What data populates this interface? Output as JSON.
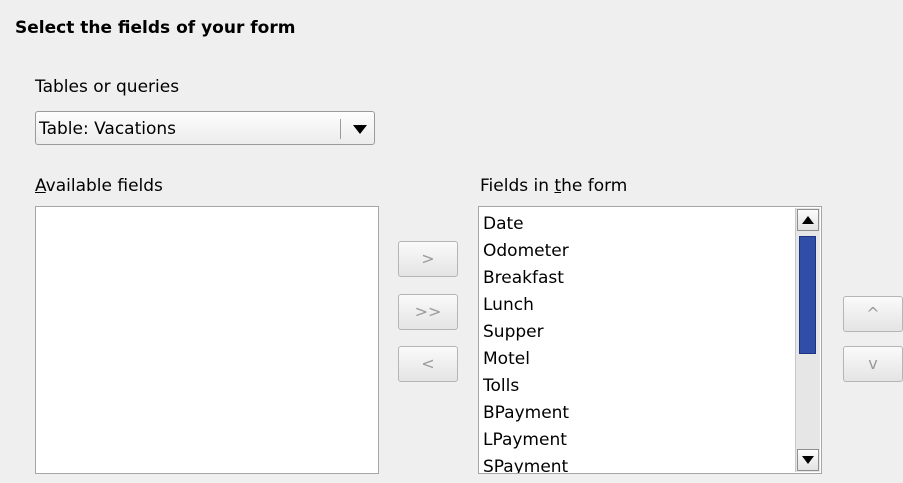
{
  "title": "Select the fields of your form",
  "tables": {
    "label": "Tables or queries",
    "selected": "Table: Vacations"
  },
  "available": {
    "label_prefix": "",
    "label_u": "A",
    "label_rest": "vailable fields",
    "items": []
  },
  "in_form": {
    "label_prefix": "Fields in ",
    "label_u": "t",
    "label_rest": "he form",
    "items": [
      "Date",
      "Odometer",
      "Breakfast",
      "Lunch",
      "Supper",
      "Motel",
      "Tolls",
      "BPayment",
      "LPayment",
      "SPayment"
    ]
  },
  "buttons": {
    "move_right": ">",
    "move_all_right": ">>",
    "move_left": "<",
    "move_up": "^",
    "move_down": "v"
  },
  "icons": {
    "dropdown": "chevron-down-icon",
    "scroll_up": "scroll-up-icon",
    "scroll_down": "scroll-down-icon"
  },
  "colors": {
    "scroll_thumb": "#304ea8"
  }
}
